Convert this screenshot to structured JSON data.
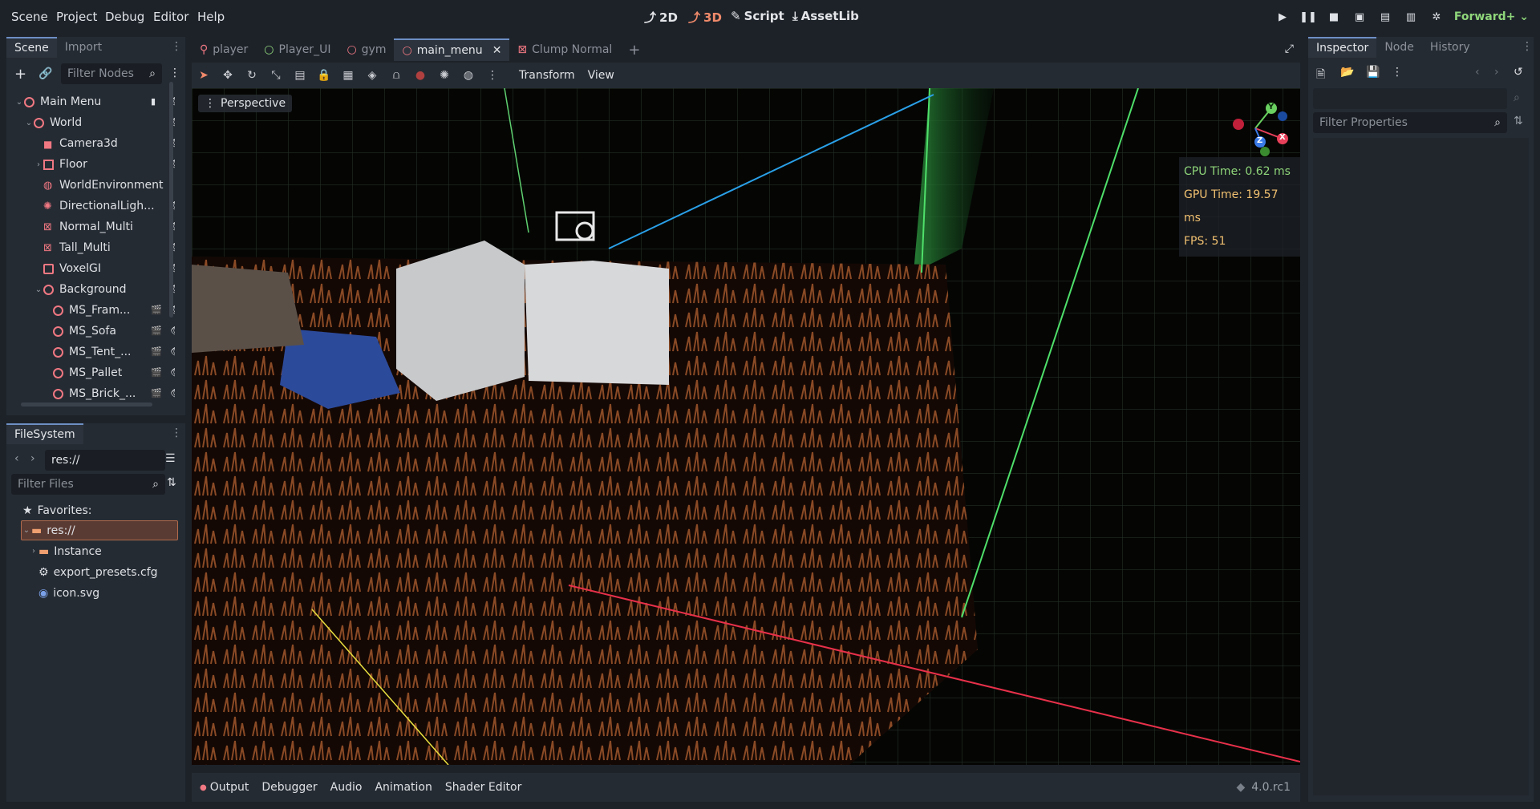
{
  "menu": [
    "Scene",
    "Project",
    "Debug",
    "Editor",
    "Help"
  ],
  "workspaces": {
    "w2d": "2D",
    "w3d": "3D",
    "script": "Script",
    "assetlib": "AssetLib"
  },
  "renderer": "Forward+",
  "scene_dock": {
    "tabs": {
      "scene": "Scene",
      "import": "Import"
    },
    "filter_placeholder": "Filter Nodes",
    "nodes": [
      {
        "label": "Main Menu"
      },
      {
        "label": "World"
      },
      {
        "label": "Camera3d"
      },
      {
        "label": "Floor"
      },
      {
        "label": "WorldEnvironment"
      },
      {
        "label": "DirectionalLigh..."
      },
      {
        "label": "Normal_Multi"
      },
      {
        "label": "Tall_Multi"
      },
      {
        "label": "VoxelGI"
      },
      {
        "label": "Background"
      },
      {
        "label": "MS_Fram..."
      },
      {
        "label": "MS_Sofa"
      },
      {
        "label": "MS_Tent_..."
      },
      {
        "label": "MS_Pallet"
      },
      {
        "label": "MS_Brick_..."
      }
    ]
  },
  "filesystem": {
    "tab": "FileSystem",
    "path": "res://",
    "filter_placeholder": "Filter Files",
    "favorites": "Favorites:",
    "items": [
      {
        "label": "res://"
      },
      {
        "label": "Instance"
      },
      {
        "label": "export_presets.cfg"
      },
      {
        "label": "icon.svg"
      }
    ]
  },
  "editor_tabs": [
    {
      "label": "player"
    },
    {
      "label": "Player_UI"
    },
    {
      "label": "gym"
    },
    {
      "label": "main_menu"
    },
    {
      "label": "Clump Normal"
    }
  ],
  "viewport_toolbar": {
    "transform": "Transform",
    "view": "View"
  },
  "viewport": {
    "perspective": "Perspective",
    "cpu_time": "CPU Time: 0.62 ms",
    "gpu_time": "GPU Time: 19.57 ms",
    "fps": "FPS: 51",
    "gizmo": {
      "x": "X",
      "y": "Y",
      "z": "Z"
    }
  },
  "bottom_panel": {
    "tabs": [
      "Output",
      "Debugger",
      "Audio",
      "Animation",
      "Shader Editor"
    ],
    "version": "4.0.rc1"
  },
  "inspector": {
    "tabs": {
      "inspector": "Inspector",
      "node": "Node",
      "history": "History"
    },
    "filter_placeholder": "Filter Properties"
  },
  "colors": {
    "accent": "#6d8fc4",
    "node_red": "#f07882",
    "active3d": "#f08a6a",
    "renderer": "#8fd67a",
    "cpu": "#8fd67a",
    "gpu": "#f0c070"
  }
}
